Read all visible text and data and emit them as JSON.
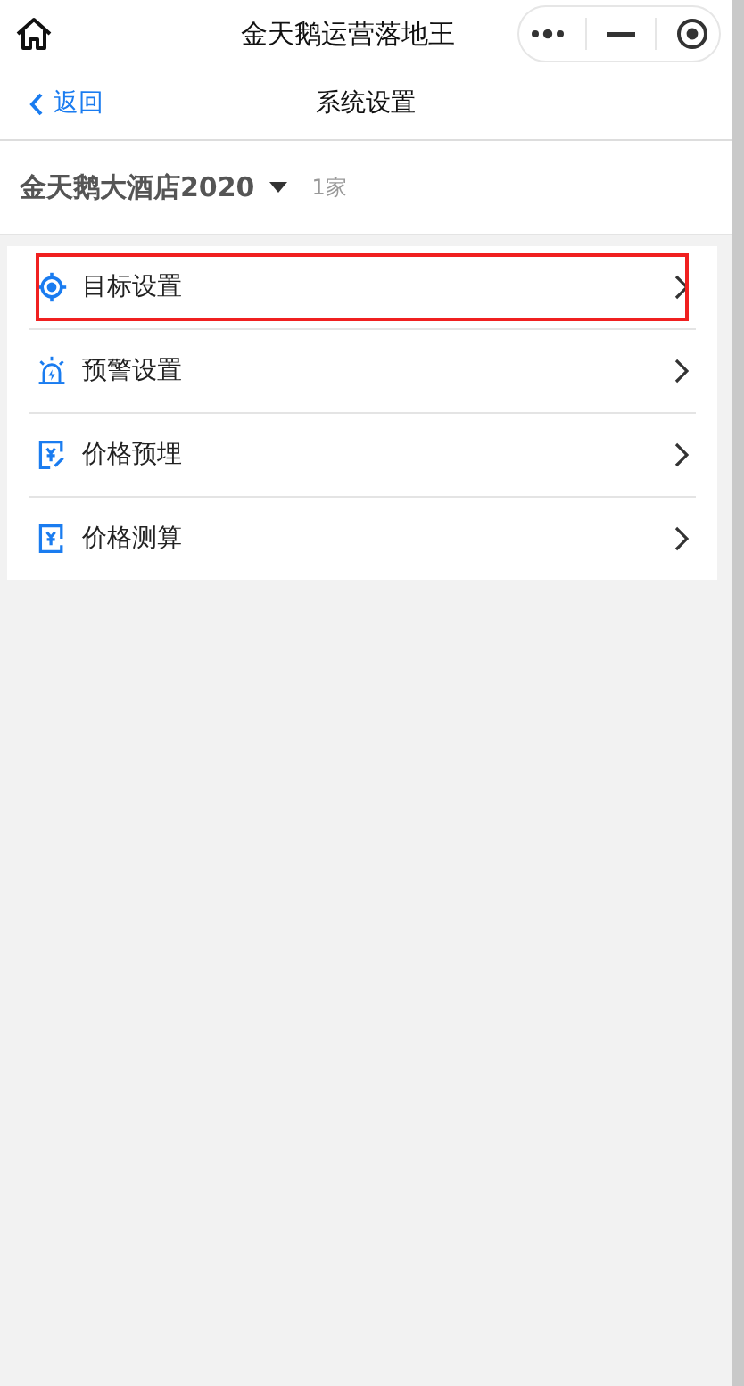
{
  "window": {
    "title": "金天鹅运营落地王"
  },
  "nav": {
    "back": "返回",
    "title": "系统设置"
  },
  "store": {
    "name": "金天鹅大酒店2020",
    "count": "1家"
  },
  "menu": [
    {
      "kind": "target",
      "label": "目标设置",
      "highlighted": true
    },
    {
      "kind": "alarm",
      "label": "预警设置",
      "highlighted": false
    },
    {
      "kind": "price-edit",
      "label": "价格预埋",
      "highlighted": false
    },
    {
      "kind": "price",
      "label": "价格测算",
      "highlighted": false
    }
  ]
}
